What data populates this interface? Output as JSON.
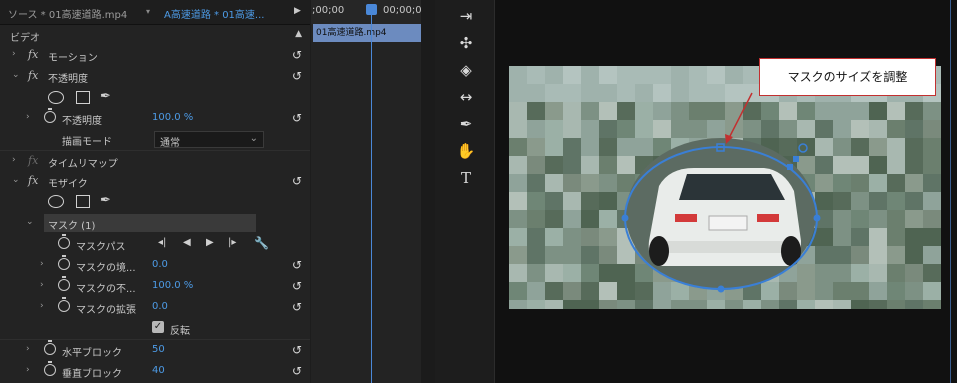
{
  "effect_controls": {
    "source_tab": "ソース * 01高速道路.mp4",
    "clip_tab": "A高速道路 * 01高速...",
    "section_video": "ビデオ",
    "motion": "モーション",
    "opacity": "不透明度",
    "opacity_prop": "不透明度",
    "opacity_value": "100.0 %",
    "blend_mode_label": "描画モード",
    "blend_mode_value": "通常",
    "time_remap": "タイムリマップ",
    "mosaic": "モザイク",
    "mask_name": "マスク (1)",
    "mask_path": "マスクパス",
    "mask_feather": "マスクの境...",
    "mask_feather_value": "0.0",
    "mask_opacity": "マスクの不...",
    "mask_opacity_value": "100.0 %",
    "mask_expansion": "マスクの拡張",
    "mask_expansion_value": "0.0",
    "inverted_label": "反転",
    "horizontal_blocks": "水平ブロック",
    "horizontal_blocks_value": "50",
    "vertical_blocks": "垂直ブロック",
    "vertical_blocks_value": "40"
  },
  "timeline": {
    "timecode_start": ";00;00",
    "timecode_next": "00;00;08",
    "clip_name": "01高速道路.mp4"
  },
  "tools": [
    "track-select-icon",
    "ripple-edit-icon",
    "razor-icon",
    "slip-icon",
    "pen-icon",
    "hand-icon",
    "type-icon"
  ],
  "monitor": {
    "callout_text": "マスクのサイズを調整"
  },
  "colors": {
    "accent": "#4d9be6",
    "callout_border": "#c23030",
    "mask_handle": "#3a7fd6"
  }
}
